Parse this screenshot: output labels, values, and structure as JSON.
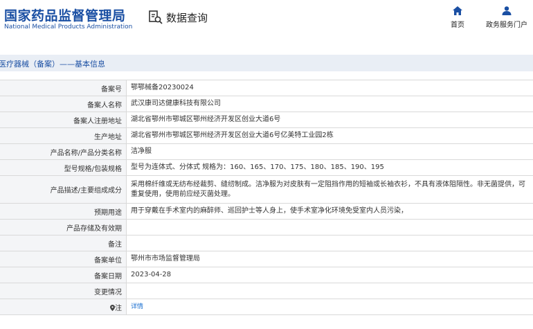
{
  "header": {
    "logo_cn": "国家药品监督管理局",
    "logo_en": "National Medical Products Administration",
    "query_title": "数据查询",
    "nav": [
      {
        "label": "首页",
        "icon": "home-icon"
      },
      {
        "label": "政务服务门户",
        "icon": "user-icon"
      }
    ]
  },
  "section_title": "医疗器械（备案）——基本信息",
  "rows": [
    {
      "label": "备案号",
      "value": "鄂鄂械备20230024"
    },
    {
      "label": "备案人名称",
      "value": "武汉康司达健康科技有限公司"
    },
    {
      "label": "备案人注册地址",
      "value": "湖北省鄂州市鄂城区鄂州经济开发区创业大道6号"
    },
    {
      "label": "生产地址",
      "value": "湖北省鄂州市鄂城区鄂州经济开发区创业大道6号亿美特工业园2栋"
    },
    {
      "label": "产品名称/产品分类名称",
      "value": "洁净服"
    },
    {
      "label": "型号规格/包装规格",
      "value": "型号为连体式、分体式 规格为：160、165、170、175、180、185、190、195"
    },
    {
      "label": "产品描述/主要组成成分",
      "value": "采用棉纤维或无纺布经裁剪、缝纫制成。洁净服为对皮肤有一定阻挡作用的短袖或长袖衣衫，不具有液体阻隔性。非无菌提供，可重复使用，使用前应经灭菌处理。"
    },
    {
      "label": "预期用途",
      "value": "用于穿戴在手术室内的麻醉师、巡回护士等人身上，使手术室净化环境免受室内人员污染，"
    },
    {
      "label": "产品存储及有效期",
      "value": ""
    },
    {
      "label": "备注",
      "value": ""
    },
    {
      "label": "备案单位",
      "value": "鄂州市市场监督管理局"
    },
    {
      "label": "备案日期",
      "value": "2023-04-28"
    },
    {
      "label": "变更情况",
      "value": ""
    }
  ],
  "note_row": {
    "label": "注",
    "link": "详情"
  },
  "colors": {
    "brand": "#1a4fa3",
    "label_bg": "#f4f5f7",
    "bar_bg": "#e9eef5",
    "link": "#1a6fd0"
  }
}
